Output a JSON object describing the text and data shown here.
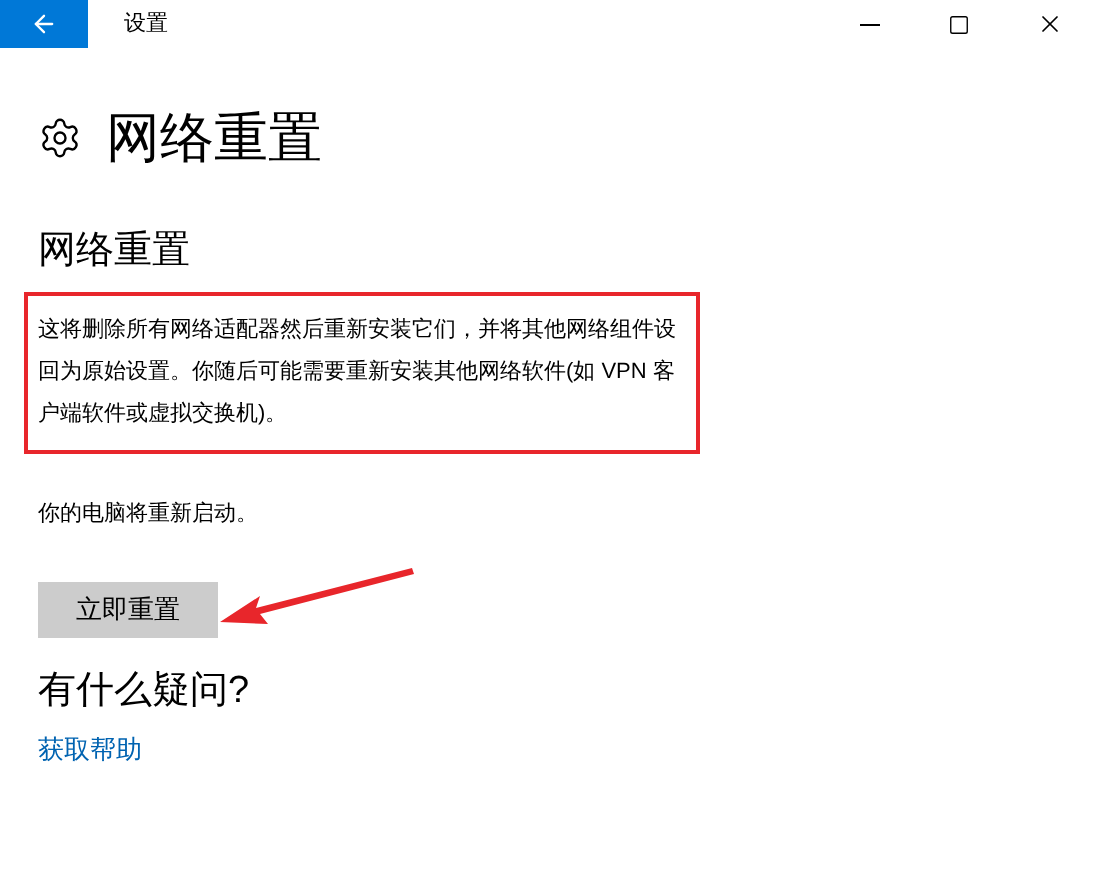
{
  "window": {
    "title": "设置"
  },
  "page": {
    "title": "网络重置"
  },
  "section": {
    "title": "网络重置",
    "description": "这将删除所有网络适配器然后重新安装它们，并将其他网络组件设回为原始设置。你随后可能需要重新安装其他网络软件(如 VPN 客户端软件或虚拟交换机)。",
    "note": "你的电脑将重新启动。",
    "button": "立即重置"
  },
  "help": {
    "title": "有什么疑问?",
    "link": "获取帮助"
  }
}
